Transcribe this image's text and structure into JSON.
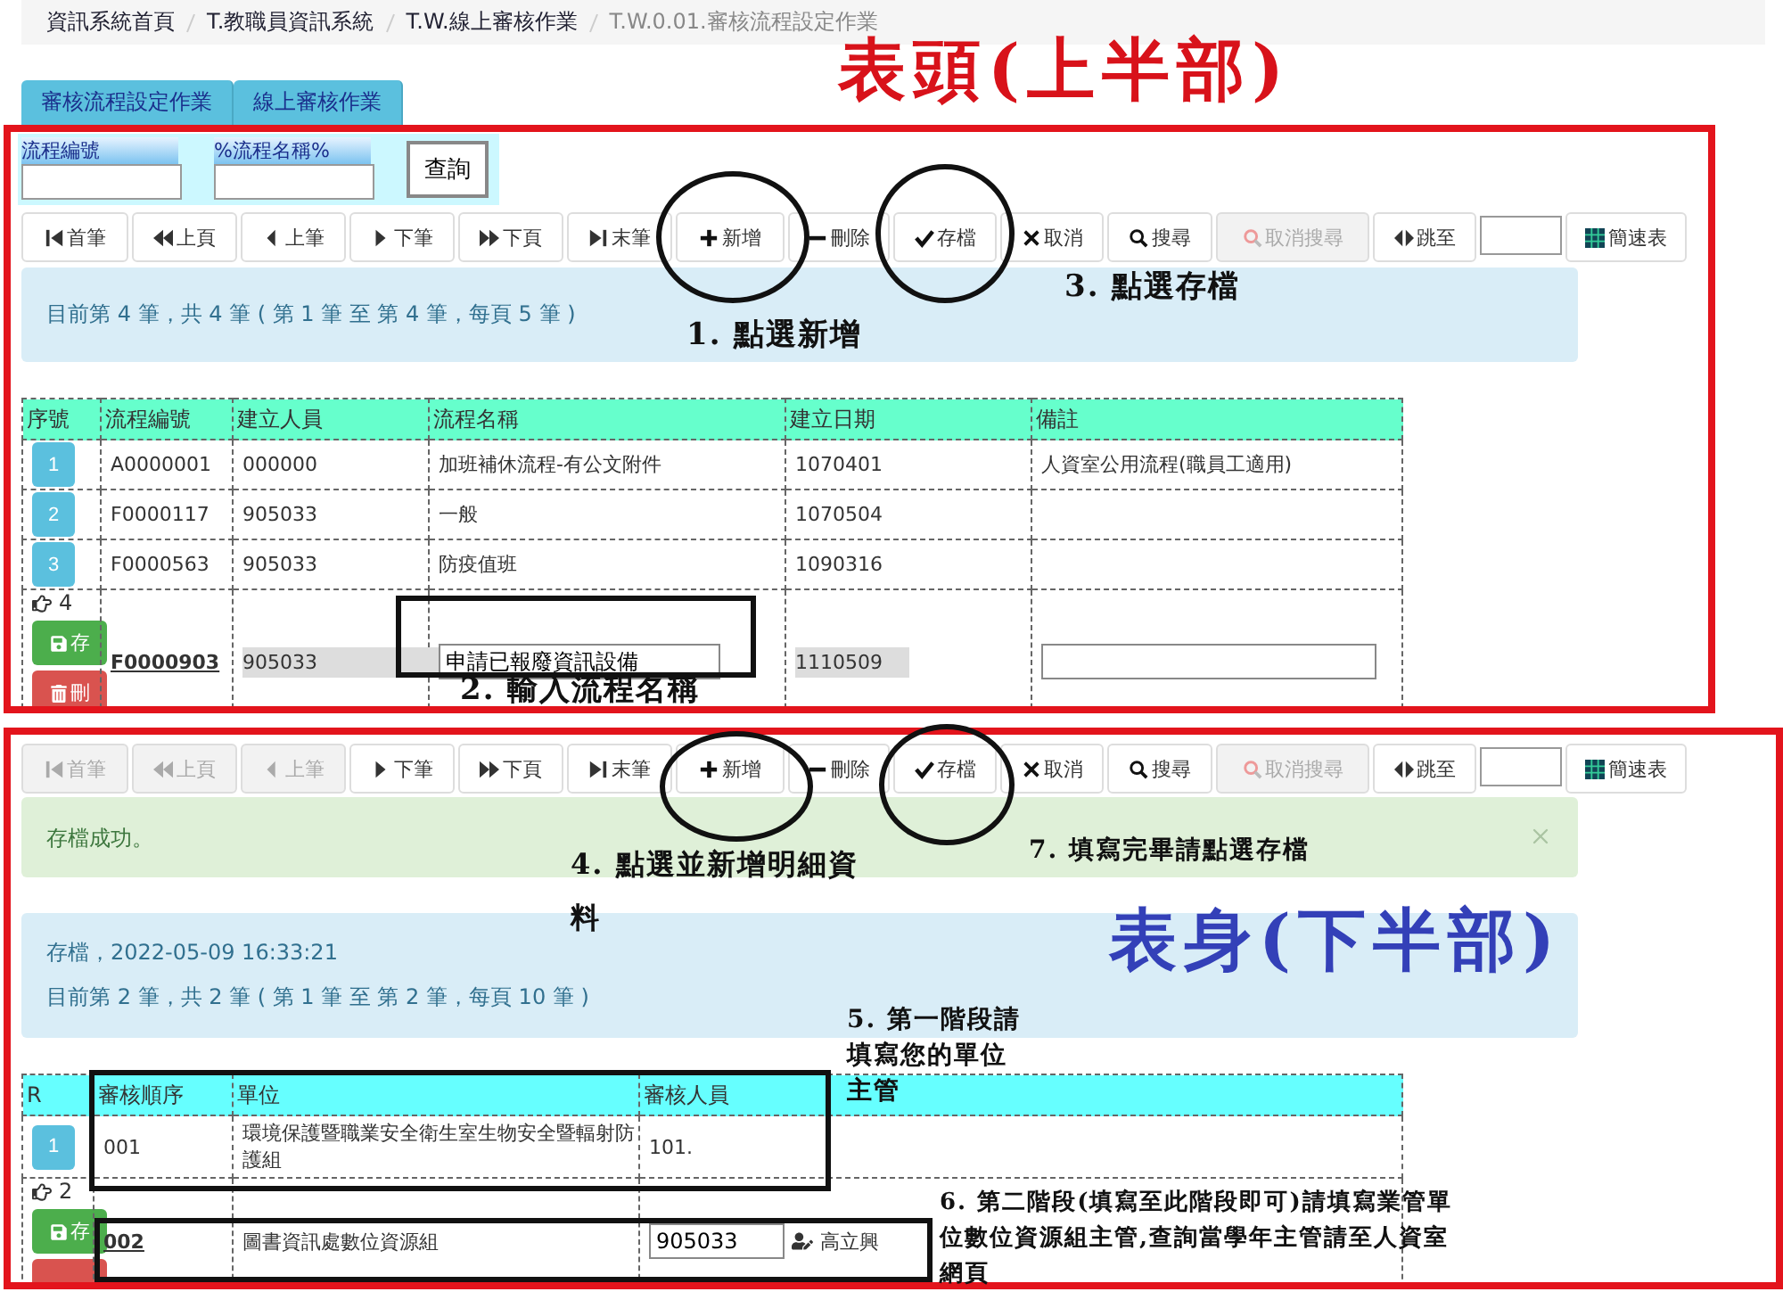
{
  "breadcrumb": [
    {
      "label": "資訊系統首頁",
      "current": false
    },
    {
      "label": "T.教職員資訊系統",
      "current": false
    },
    {
      "label": "T.W.線上審核作業",
      "current": false
    },
    {
      "label": "T.W.0.01.審核流程設定作業",
      "current": true
    }
  ],
  "tabs": [
    {
      "label": "審核流程設定作業"
    },
    {
      "label": "線上審核作業"
    }
  ],
  "header_part": {
    "query": {
      "fields": [
        {
          "label": "流程編號"
        },
        {
          "label": "%流程名稱%"
        }
      ],
      "button": "查詢"
    },
    "toolbar": [
      {
        "kind": "first",
        "label": "首筆",
        "disabled": false
      },
      {
        "kind": "prev-page",
        "label": "上頁",
        "disabled": false
      },
      {
        "kind": "prev",
        "label": "上筆",
        "disabled": false
      },
      {
        "kind": "next",
        "label": "下筆",
        "disabled": false
      },
      {
        "kind": "next-page",
        "label": "下頁",
        "disabled": false
      },
      {
        "kind": "last",
        "label": "末筆",
        "disabled": false
      },
      {
        "kind": "add",
        "label": "新增",
        "disabled": false
      },
      {
        "kind": "delete",
        "label": "刪除",
        "disabled": false
      },
      {
        "kind": "save",
        "label": "存檔",
        "disabled": false
      },
      {
        "kind": "cancel",
        "label": "取消",
        "disabled": false
      },
      {
        "kind": "search",
        "label": "搜尋",
        "disabled": false
      },
      {
        "kind": "cancel-search",
        "label": "取消搜尋",
        "disabled": true
      },
      {
        "kind": "jump",
        "label": "跳至",
        "disabled": false
      },
      {
        "kind": "field"
      },
      {
        "kind": "table",
        "label": "簡速表",
        "disabled": false
      }
    ],
    "info": [
      "目前第 4 筆，共 4 筆 ( 第 1 筆 至 第 4 筆，每頁 5 筆 )"
    ],
    "table": {
      "columns": [
        "序號",
        "流程編號",
        "建立人員",
        "流程名稱",
        "建立日期",
        "備註"
      ],
      "rows": [
        {
          "cells": [
            "1",
            "A0000001",
            "000000",
            "加班補休流程-有公文附件",
            "1070401",
            "人資室公用流程(職員工適用)"
          ]
        },
        {
          "cells": [
            "2",
            "F0000117",
            "905033",
            "一般",
            "1070504",
            ""
          ]
        },
        {
          "cells": [
            "3",
            "F0000563",
            "905033",
            "防疫值班",
            "1090316",
            ""
          ]
        }
      ],
      "edit_row": {
        "marker": "4",
        "save": "存",
        "delete": "刪",
        "code": "F0000903",
        "creator": "905033",
        "name_value": "申請已報廢資訊設備",
        "date": "1110509"
      }
    }
  },
  "body_part": {
    "toolbar": [
      {
        "kind": "first",
        "label": "首筆",
        "disabled": true
      },
      {
        "kind": "prev-page",
        "label": "上頁",
        "disabled": true
      },
      {
        "kind": "prev",
        "label": "上筆",
        "disabled": true
      },
      {
        "kind": "next",
        "label": "下筆",
        "disabled": false
      },
      {
        "kind": "next-page",
        "label": "下頁",
        "disabled": false
      },
      {
        "kind": "last",
        "label": "末筆",
        "disabled": false
      },
      {
        "kind": "add",
        "label": "新增",
        "disabled": false
      },
      {
        "kind": "delete",
        "label": "刪除",
        "disabled": false
      },
      {
        "kind": "save",
        "label": "存檔",
        "disabled": false
      },
      {
        "kind": "cancel",
        "label": "取消",
        "disabled": false
      },
      {
        "kind": "search",
        "label": "搜尋",
        "disabled": false
      },
      {
        "kind": "cancel-search",
        "label": "取消搜尋",
        "disabled": true
      },
      {
        "kind": "jump",
        "label": "跳至",
        "disabled": false
      },
      {
        "kind": "field"
      },
      {
        "kind": "table",
        "label": "簡速表",
        "disabled": false
      }
    ],
    "alert": "存檔成功。",
    "info": [
      "存檔，2022-05-09 16:33:21",
      "目前第 2 筆，共 2 筆 ( 第 1 筆 至 第 2 筆，每頁 10 筆 )"
    ],
    "table": {
      "columns": [
        "R",
        "審核順序",
        "單位",
        "審核人員"
      ],
      "rows": [
        {
          "cells": [
            "1",
            "001",
            "環境保護暨職業安全衛生室生物安全暨輻射防護組",
            "101."
          ]
        }
      ],
      "edit_row": {
        "marker": "2",
        "save": "存",
        "order": "002",
        "unit": "圖書資訊處數位資源組",
        "reviewer_value": "905033",
        "reviewer_name": "高立興"
      }
    }
  },
  "annotations": {
    "header_title": "表頭(上半部)",
    "body_title": "表身(下半部)",
    "notes": [
      "3. 點選存檔",
      "1. 點選新增",
      "2. 輸入流程名稱",
      "7. 填寫完畢請點選存檔",
      "4. 點選並新增明細資料",
      "5. 第一階段請填寫您的單位主管",
      "6. 第二階段(填寫至此階段即可)請填寫業管單位數位資源組主管,查詢當學年主管請至人資室網頁"
    ]
  }
}
